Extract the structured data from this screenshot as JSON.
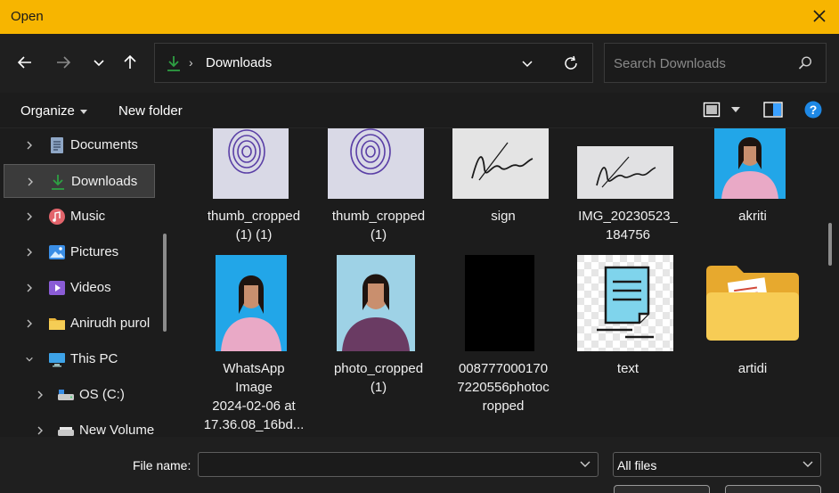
{
  "window": {
    "title": "Open"
  },
  "address": {
    "crumb": "Downloads"
  },
  "search": {
    "placeholder": "Search Downloads"
  },
  "commands": {
    "organize": "Organize",
    "new_folder": "New folder"
  },
  "sidebar": {
    "items": [
      {
        "label": "Documents",
        "icon": "documents-icon"
      },
      {
        "label": "Downloads",
        "icon": "downloads-icon",
        "selected": true
      },
      {
        "label": "Music",
        "icon": "music-icon"
      },
      {
        "label": "Pictures",
        "icon": "pictures-icon"
      },
      {
        "label": "Videos",
        "icon": "videos-icon"
      },
      {
        "label": "Anirudh purol",
        "icon": "folder-icon"
      },
      {
        "label": "This PC",
        "icon": "this-pc-icon",
        "expanded": true
      },
      {
        "label": "OS (C:)",
        "icon": "drive-icon"
      },
      {
        "label": "New Volume",
        "icon": "drive-icon"
      }
    ]
  },
  "files": [
    {
      "label_lines": [
        "thumb_cropped",
        "(1) (1)"
      ],
      "kind": "fingerprint"
    },
    {
      "label_lines": [
        "thumb_cropped",
        "(1)"
      ],
      "kind": "fingerprint"
    },
    {
      "label_lines": [
        "sign"
      ],
      "kind": "signature"
    },
    {
      "label_lines": [
        "IMG_20230523_",
        "184756"
      ],
      "kind": "signature"
    },
    {
      "label_lines": [
        "akriti"
      ],
      "kind": "portrait"
    },
    {
      "label_lines": [
        "WhatsApp",
        "Image",
        "2024-02-06 at",
        "17.36.08_16bd..."
      ],
      "kind": "portrait"
    },
    {
      "label_lines": [
        "photo_cropped",
        "(1)"
      ],
      "kind": "portrait"
    },
    {
      "label_lines": [
        "008777000170",
        "7220556photoc",
        "ropped"
      ],
      "kind": "black-image"
    },
    {
      "label_lines": [
        "text"
      ],
      "kind": "text-file"
    },
    {
      "label_lines": [
        "artidi"
      ],
      "kind": "folder"
    }
  ],
  "footer": {
    "file_name_label": "File name:",
    "file_name_value": "",
    "file_type": "All files"
  },
  "colors": {
    "titlebar": "#f7b500",
    "accent": "#2ea043"
  }
}
